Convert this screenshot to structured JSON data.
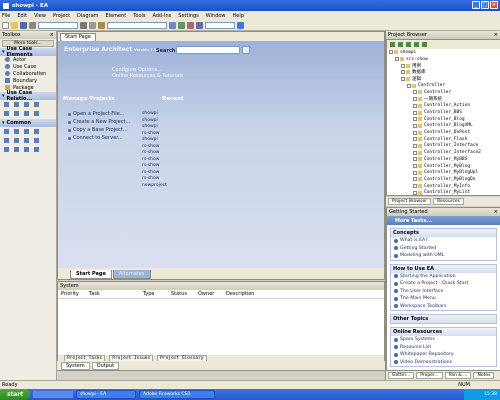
{
  "window": {
    "title": "showpi - EA"
  },
  "menu": [
    "File",
    "Edit",
    "View",
    "Project",
    "Diagram",
    "Element",
    "Tools",
    "Add-Ins",
    "Settings",
    "Window",
    "Help"
  ],
  "toolbox": {
    "title": "Toolbox",
    "more_tools": "More tools...",
    "group1": "Use Case Elements",
    "group1_items": [
      "Actor",
      "Use Case",
      "Collaboration",
      "Boundary",
      "Package"
    ],
    "group2": "Use Case Relatio...",
    "group3": "Common"
  },
  "start_page": {
    "tab": "Start Page",
    "product": "Enterprise Architect",
    "version": "Version 7.5",
    "search_label": "Search",
    "links_top": [
      "Configure Options...",
      "Online Resources & Tutorials"
    ],
    "manage_heading": "Manage Projects",
    "manage_items": [
      "Open a Project File...",
      "Create a New Project...",
      "Copy a Base Project...",
      "Connect to Server..."
    ],
    "recent_heading": "Recent",
    "recent_items": [
      "showpi",
      "showpi",
      "showpi",
      "rs-show",
      "showpi",
      "rs-show",
      "rs-show",
      "rs-show",
      "rs-show",
      "rs-show",
      "rs-show",
      "newproject"
    ],
    "bottom_tabs": [
      "Start Page",
      "Alternates"
    ]
  },
  "system": {
    "title": "System",
    "columns": [
      "Priority",
      "Task",
      "Type",
      "Status",
      "Owner",
      "Description"
    ],
    "subtabs": [
      "Project Tasks",
      "Project Issues",
      "Project Glossary"
    ],
    "output_tabs": [
      "System",
      "Output"
    ]
  },
  "project_browser": {
    "title": "Project Browser",
    "nodes": [
      {
        "label": "showpi",
        "level": 0
      },
      {
        "label": "src-show",
        "level": 1
      },
      {
        "label": "用例",
        "level": 2
      },
      {
        "label": "数据库",
        "level": 2
      },
      {
        "label": "逻辑",
        "level": 2
      },
      {
        "label": "Controller",
        "level": 3
      },
      {
        "label": "Controller",
        "level": 4
      },
      {
        "label": "一期系统",
        "level": 4
      },
      {
        "label": "Controller_Action",
        "level": 4
      },
      {
        "label": "Controller_BBS",
        "level": 4
      },
      {
        "label": "Controller_Blog",
        "level": 4
      },
      {
        "label": "Controller_BlogXML",
        "level": 4
      },
      {
        "label": "Controller_DoPost",
        "level": 4
      },
      {
        "label": "Controller_Flash",
        "level": 4
      },
      {
        "label": "Controller_Interface",
        "level": 4
      },
      {
        "label": "Controller_Interface2",
        "level": 4
      },
      {
        "label": "Controller_MyBBS",
        "level": 4
      },
      {
        "label": "Controller_MyBlog",
        "level": 4
      },
      {
        "label": "Controller_MyBlogUpl",
        "level": 4
      },
      {
        "label": "Controller_MyBlogDo",
        "level": 4
      },
      {
        "label": "Controller_MyInfo",
        "level": 4
      },
      {
        "label": "Controller_MyList",
        "level": 4
      },
      {
        "label": "Controller_MyMessager",
        "level": 4
      },
      {
        "label": "Controller_MyAdmin",
        "level": 4
      }
    ],
    "tabs": [
      "Project Browser",
      "Resources"
    ]
  },
  "getting_started": {
    "title": "Getting Started",
    "more_tasks": "More Tasks...",
    "sections": [
      {
        "heading": "Concepts",
        "items": [
          "What is EA?",
          "Getting Started",
          "Modeling with UML"
        ]
      },
      {
        "heading": "How to Use EA",
        "items": [
          "Starting the Application",
          "Create a Project - Quick Start",
          "The User Interface",
          "The Main Menu",
          "Workspace Toolbars"
        ]
      },
      {
        "heading": "Other Topics",
        "items": []
      },
      {
        "heading": "Online Resources",
        "items": [
          "Sparx Systems",
          "Resource List",
          "Whitepaper Repository",
          "Video Demonstrations"
        ]
      }
    ],
    "bottom_tabs": [
      "Gettin...",
      "Proper...",
      "Pan & ...",
      "Notes"
    ]
  },
  "status": {
    "left": "Ready",
    "right": "NUM"
  },
  "taskbar": {
    "start": "start",
    "tasks": [
      "showpi - EA",
      "Adobe Fireworks CS3"
    ],
    "clock": "15:38"
  }
}
